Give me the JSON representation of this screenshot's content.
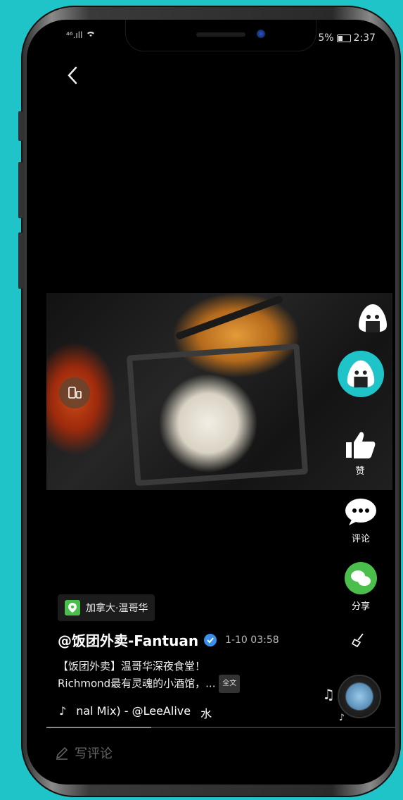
{
  "status_bar": {
    "signal": "⁴⁶.ıll",
    "battery": "5%",
    "time": "2:37"
  },
  "location": {
    "label": "加拿大·温哥华"
  },
  "post": {
    "account": "@饭团外卖-Fantuan",
    "time": "1-10 03:58",
    "description_line1": "【饭团外卖】温哥华深夜食堂！",
    "description_line2": "Richmond最有灵魂的小酒馆，...",
    "more_label": "全文",
    "music": "nal Mix) - @LeeAlive",
    "music_trailing": "水"
  },
  "actions": {
    "like_label": "赞",
    "comment_label": "评论",
    "share_label": "分享"
  },
  "comment_bar": {
    "placeholder": "写评论"
  },
  "progress": 0.3,
  "colors": {
    "background": "#1fc4c8",
    "avatar": "#1fc4c8",
    "share_green": "#4bbf4b",
    "verified_blue": "#3a8fe8"
  },
  "icons": [
    "back-icon",
    "rotate-icon",
    "like-icon",
    "comment-icon",
    "share-wechat-icon",
    "broom-icon",
    "music-note-icon",
    "location-icon",
    "verified-icon",
    "edit-icon"
  ]
}
